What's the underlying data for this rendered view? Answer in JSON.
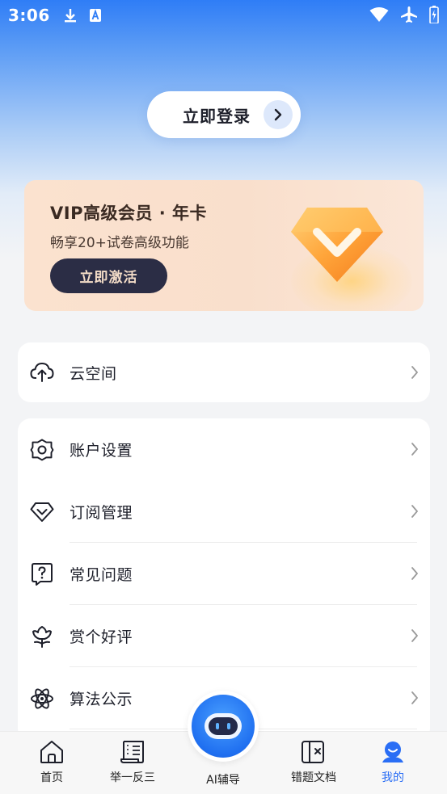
{
  "status_bar": {
    "time": "3:06",
    "left_icons": [
      "download-icon",
      "a-square-icon"
    ],
    "right_icons": [
      "wifi-icon",
      "airplane-icon",
      "battery-icon"
    ]
  },
  "login": {
    "label": "立即登录"
  },
  "vip": {
    "title": "VIP高级会员 · 年卡",
    "subtitle": "畅享20+试卷高级功能",
    "button": "立即激活"
  },
  "cloud": {
    "label": "云空间"
  },
  "menu": [
    {
      "label": "账户设置",
      "icon": "gear-icon"
    },
    {
      "label": "订阅管理",
      "icon": "diamond-icon"
    },
    {
      "label": "常见问题",
      "icon": "question-icon"
    },
    {
      "label": "赏个好评",
      "icon": "flower-icon"
    },
    {
      "label": "算法公示",
      "icon": "atom-icon"
    }
  ],
  "tabbar": {
    "home": "首页",
    "similar": "举一反三",
    "ai": "AI辅导",
    "mistakes": "错题文档",
    "mine": "我的"
  },
  "colors": {
    "accent": "#2a6ef5",
    "vip_button": "#2b2d45"
  }
}
